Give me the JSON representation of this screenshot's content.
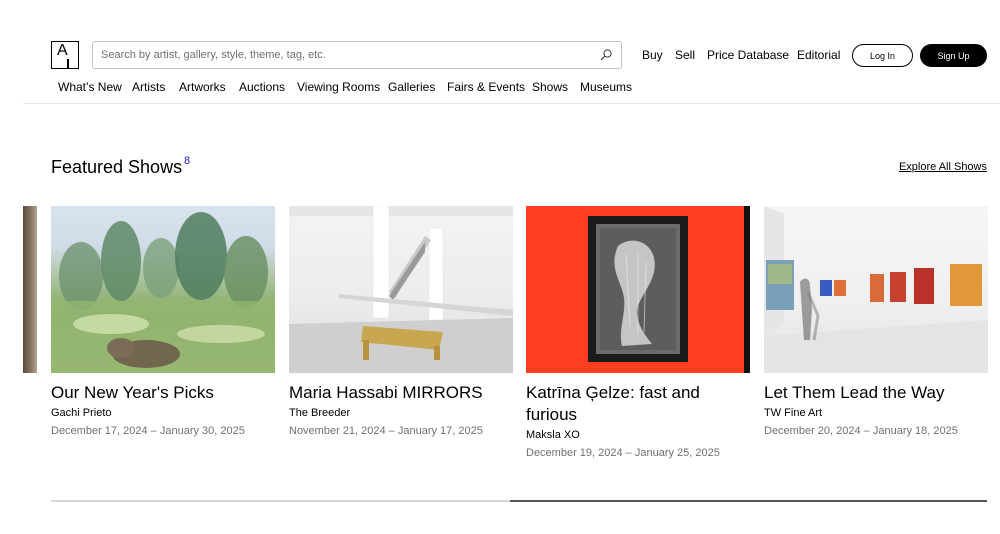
{
  "header": {
    "logo_letter": "A",
    "search": {
      "placeholder": "Search by artist, gallery, style, theme, tag, etc.",
      "value": ""
    },
    "top_links": [
      "Buy",
      "Sell",
      "Price Database",
      "Editorial"
    ],
    "login_label": "Log In",
    "signup_label": "Sign Up",
    "nav": [
      "What’s New",
      "Artists",
      "Artworks",
      "Auctions",
      "Viewing Rooms",
      "Galleries",
      "Fairs & Events",
      "Shows",
      "Museums"
    ]
  },
  "section": {
    "title": "Featured Shows",
    "count": "8",
    "explore_label": "Explore All Shows"
  },
  "shows": [
    {
      "title": "Our New Year's Picks",
      "partner": "Gachi Prieto",
      "dates": "December 17, 2024 – January 30, 2025"
    },
    {
      "title": "Maria Hassabi MIRRORS",
      "partner": "The Breeder",
      "dates": "November 21, 2024 – January 17, 2025"
    },
    {
      "title": "Katrīna Ģelze: fast and furious",
      "partner": "Maksla XO",
      "dates": "December 19, 2024 – January 25, 2025"
    },
    {
      "title": "Let Them Lead the Way",
      "partner": "TW Fine Art",
      "dates": "December 20, 2024 – January 18, 2025"
    }
  ],
  "carousel": {
    "progress_start": 0.49,
    "progress_end": 1.0
  },
  "colors": {
    "accent_count": "#1023d7",
    "date_gray": "#707070",
    "thumb3_bg": "#ff3d1f"
  }
}
